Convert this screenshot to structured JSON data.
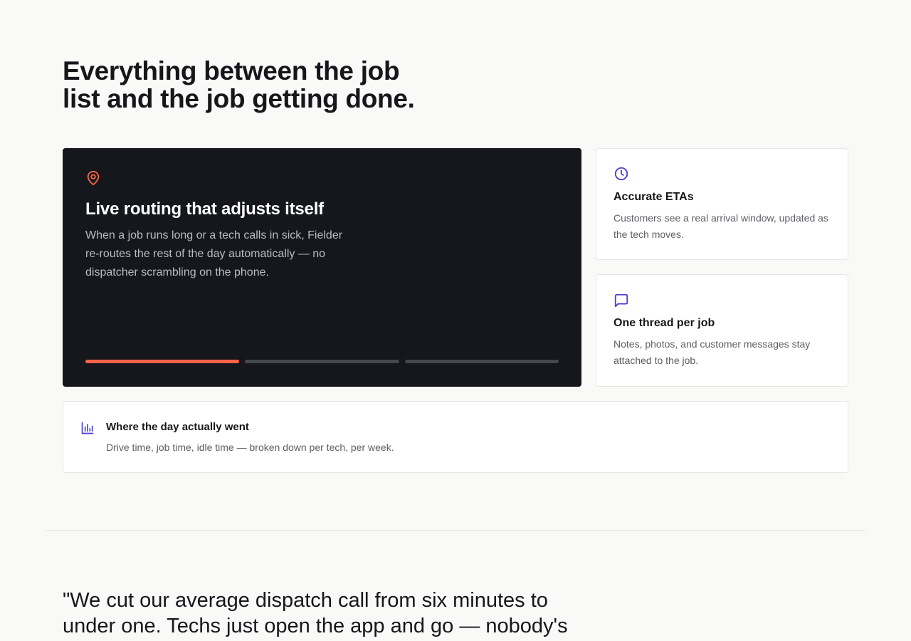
{
  "section": {
    "headline": "Everything between the job list and the job getting done."
  },
  "feature_main": {
    "icon": "map-pin-icon",
    "title": "Live routing that adjusts itself",
    "description": "When a job runs long or a tech calls in sick, Fielder re-routes the rest of the day automatically — no dispatcher scrambling on the phone.",
    "slides_total": 3,
    "active_slide": 1,
    "accent_color": "#ff6347"
  },
  "cards": {
    "eta": {
      "icon": "clock-icon",
      "title": "Accurate ETAs",
      "description": "Customers see a real arrival window, updated as the tech moves."
    },
    "thread": {
      "icon": "message-square-icon",
      "title": "One thread per job",
      "description": "Notes, photos, and customer messages stay attached to the job."
    },
    "day": {
      "icon": "bar-chart-icon",
      "title": "Where the day actually went",
      "description": "Drive time, job time, idle time — broken down per tech, per week."
    }
  },
  "testimonial": {
    "quote": "\"We cut our average dispatch call from six minutes to under one. Techs just open the app and go — nobody's"
  },
  "colors": {
    "icon_accent": "#4b3fd1",
    "dark_card": "#15171c",
    "background": "#f9f9f8"
  }
}
